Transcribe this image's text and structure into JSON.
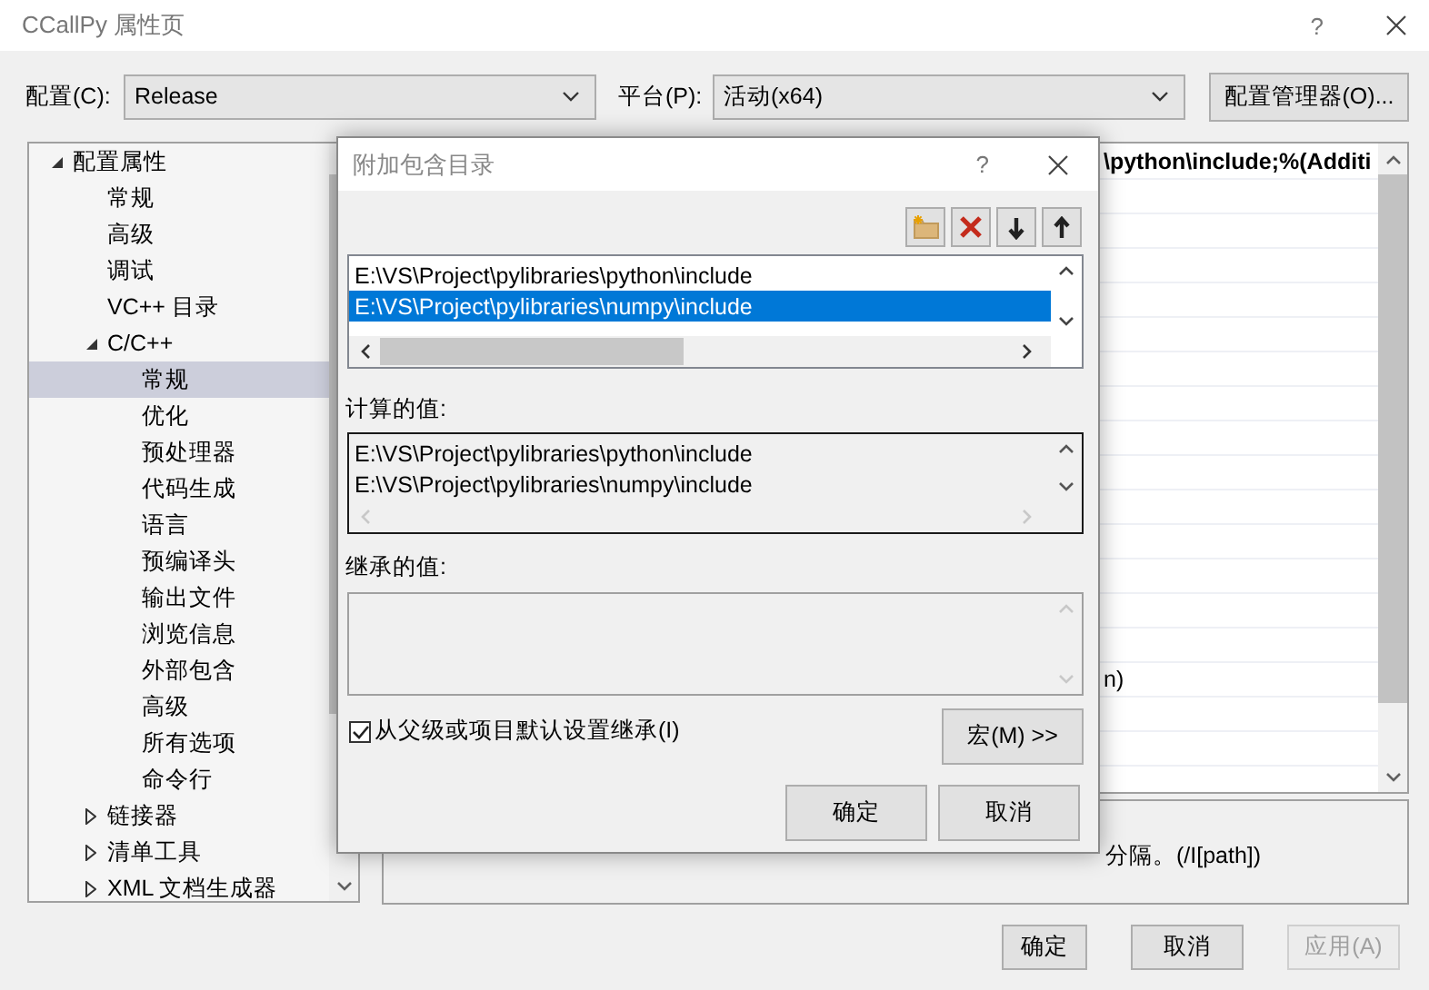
{
  "window": {
    "title": "CCallPy 属性页",
    "help": "?"
  },
  "config_bar": {
    "config_label": "配置(C):",
    "config_value": "Release",
    "platform_label": "平台(P):",
    "platform_value": "活动(x64)",
    "manager_button": "配置管理器(O)..."
  },
  "tree": [
    {
      "label": "配置属性",
      "expanded": true,
      "selected": false,
      "children": [
        {
          "label": "常规",
          "selected": false
        },
        {
          "label": "高级",
          "selected": false
        },
        {
          "label": "调试",
          "selected": false
        },
        {
          "label": "VC++ 目录",
          "selected": false
        },
        {
          "label": "C/C++",
          "expanded": true,
          "selected": false,
          "children": [
            {
              "label": "常规",
              "selected": true
            },
            {
              "label": "优化",
              "selected": false
            },
            {
              "label": "预处理器",
              "selected": false
            },
            {
              "label": "代码生成",
              "selected": false
            },
            {
              "label": "语言",
              "selected": false
            },
            {
              "label": "预编译头",
              "selected": false
            },
            {
              "label": "输出文件",
              "selected": false
            },
            {
              "label": "浏览信息",
              "selected": false
            },
            {
              "label": "外部包含",
              "selected": false
            },
            {
              "label": "高级",
              "selected": false
            },
            {
              "label": "所有选项",
              "selected": false
            },
            {
              "label": "命令行",
              "selected": false
            }
          ]
        },
        {
          "label": "链接器",
          "expanded": false,
          "selected": false
        },
        {
          "label": "清单工具",
          "expanded": false,
          "selected": false
        },
        {
          "label": "XML 文档生成器",
          "expanded": false,
          "selected": false
        }
      ]
    }
  ],
  "property_grid": {
    "visible_values": [
      {
        "text": "\\python\\include;%(Additi",
        "bold": true
      },
      {
        "text": "n)",
        "bold": false
      }
    ]
  },
  "description": "分隔。(/I[path])",
  "buttons": [
    {
      "label": "确定",
      "disabled": false
    },
    {
      "label": "取消",
      "disabled": false
    },
    {
      "label": "应用(A)",
      "disabled": true
    }
  ],
  "dialog": {
    "title": "附加包含目录",
    "help": "?",
    "entries": [
      {
        "text": "E:\\VS\\Project\\pylibraries\\python\\include",
        "selected": false
      },
      {
        "text": "E:\\VS\\Project\\pylibraries\\numpy\\include",
        "selected": true
      }
    ],
    "computed_label": "计算的值:",
    "computed": [
      "E:\\VS\\Project\\pylibraries\\python\\include",
      "E:\\VS\\Project\\pylibraries\\numpy\\include"
    ],
    "inherited_label": "继承的值:",
    "inherit": {
      "label": "从父级或项目默认设置继承(I)",
      "checked": true
    },
    "macros_button": "宏(M) >>",
    "buttons": [
      "确定",
      "取消"
    ]
  }
}
